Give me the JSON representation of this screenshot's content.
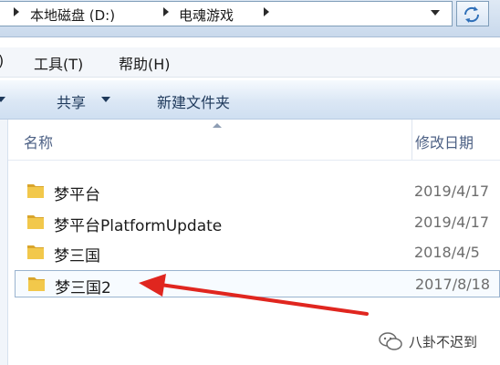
{
  "address_bar": {
    "crumbs": [
      "本地磁盘 (D:)",
      "电魂游戏"
    ]
  },
  "menu": {
    "items": [
      ")",
      "工具(T)",
      "帮助(H)"
    ]
  },
  "command_bar": {
    "share_label": "共享",
    "new_folder_label": "新建文件夹"
  },
  "columns": {
    "name": "名称",
    "modified": "修改日期"
  },
  "files": [
    {
      "name": "梦平台",
      "modified": "2019/4/17"
    },
    {
      "name": "梦平台PlatformUpdate",
      "modified": "2019/4/17"
    },
    {
      "name": "梦三国",
      "modified": "2018/4/5"
    },
    {
      "name": "梦三国2",
      "modified": "2017/8/18"
    }
  ],
  "watermark": {
    "text": "八卦不迟到"
  },
  "colors": {
    "annotation_arrow": "#e0261f",
    "folder": "#e8b93c"
  }
}
